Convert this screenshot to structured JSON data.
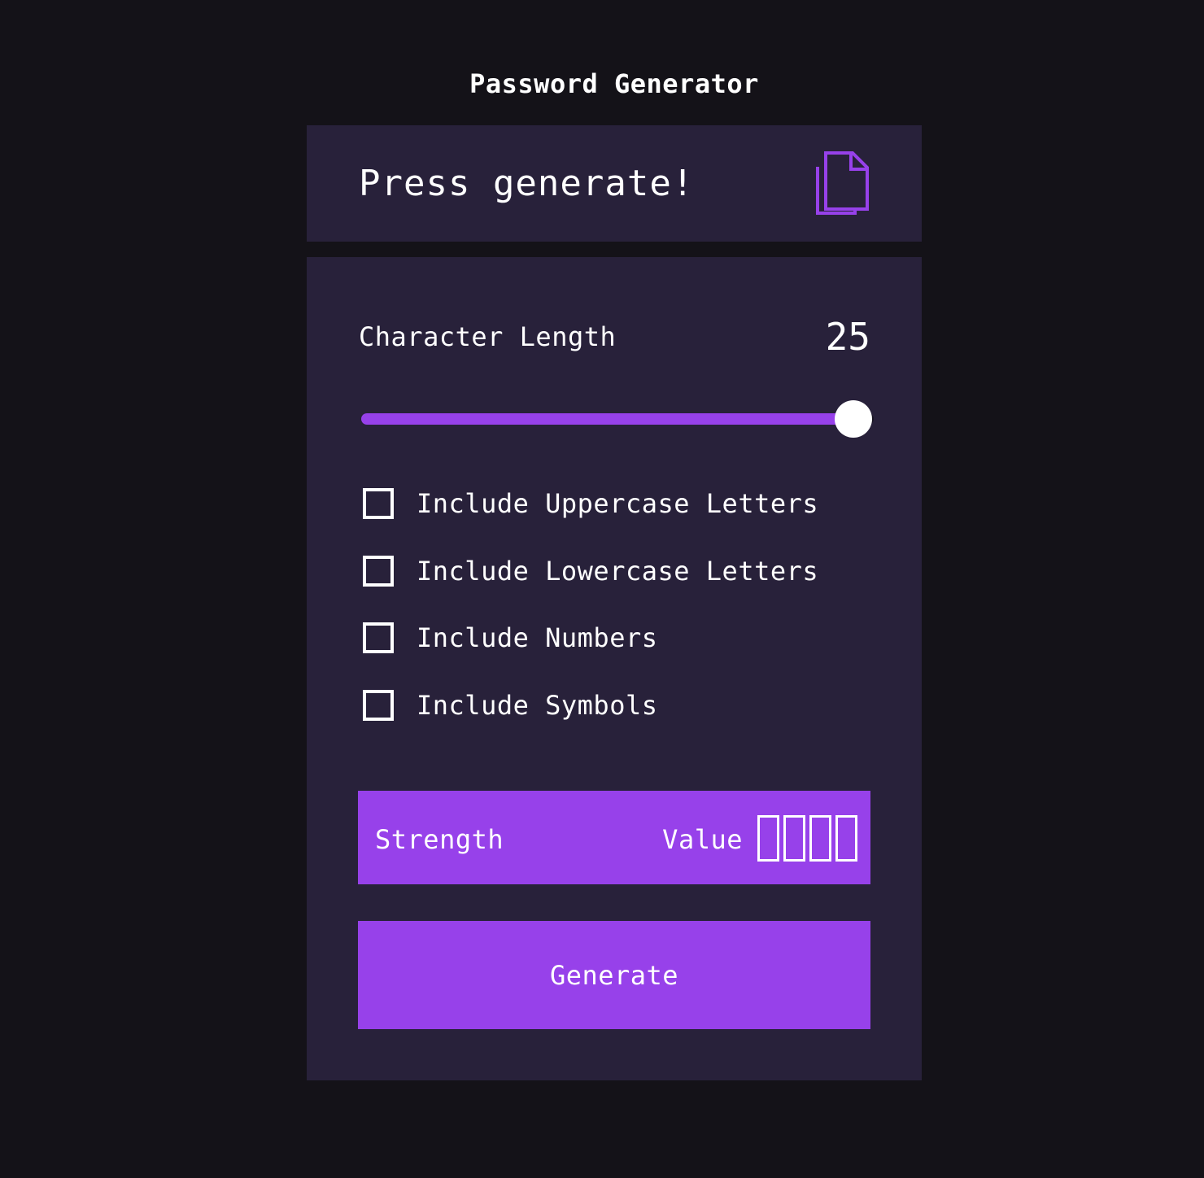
{
  "app": {
    "title": "Password Generator"
  },
  "output": {
    "text": "Press generate!",
    "copy_icon": "copy-documents-icon"
  },
  "settings": {
    "length_label": "Character Length",
    "length_value": "25",
    "slider": {
      "value": 25,
      "fill_fraction": 0.96
    },
    "options": [
      {
        "label": "Include Uppercase Letters",
        "checked": false
      },
      {
        "label": "Include Lowercase Letters",
        "checked": false
      },
      {
        "label": "Include Numbers",
        "checked": false
      },
      {
        "label": "Include Symbols",
        "checked": false
      }
    ],
    "strength": {
      "label": "Strength",
      "value": "Value",
      "bars_total": 4,
      "bars_filled": 0
    },
    "generate_label": "Generate"
  },
  "colors": {
    "background": "#141218",
    "panel": "#28213a",
    "accent": "#9741ea",
    "text": "#ffffff"
  }
}
